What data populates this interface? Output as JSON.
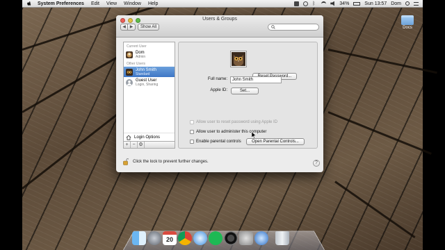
{
  "menubar": {
    "app_name": "System Preferences",
    "items": [
      "Edit",
      "View",
      "Window",
      "Help"
    ],
    "battery": "34%",
    "clock": "Sun 13:57",
    "user": "Dom"
  },
  "desktop": {
    "docs_label": "Docs"
  },
  "window": {
    "title": "Users & Groups",
    "show_all": "Show All",
    "search_placeholder": ""
  },
  "sidebar": {
    "current_user_header": "Current User",
    "other_users_header": "Other Users",
    "current_user": {
      "name": "Dom",
      "role": "Admin"
    },
    "other_users": [
      {
        "name": "John Smith",
        "role": "Standard",
        "selected": true
      },
      {
        "name": "Guest User",
        "role": "Login, Sharing",
        "selected": false
      }
    ],
    "login_options": "Login Options",
    "tools": [
      "+",
      "−",
      "⚙"
    ]
  },
  "detail": {
    "reset_password": "Reset Password...",
    "full_name_label": "Full name:",
    "full_name_value": "John Smith",
    "apple_id_label": "Apple ID:",
    "apple_id_button": "Set...",
    "checkboxes": [
      {
        "label": "Allow user to reset password using Apple ID",
        "checked": false,
        "disabled": true
      },
      {
        "label": "Allow user to administer this computer",
        "checked": false,
        "disabled": false
      },
      {
        "label": "Enable parental controls",
        "checked": false,
        "disabled": false
      }
    ],
    "parental_controls_button": "Open Parental Controls..."
  },
  "footer": {
    "lock_text": "Click the lock to prevent further changes.",
    "help": "?"
  },
  "dock": {
    "icons": [
      "finder-icon",
      "launchpad-icon",
      "calendar-icon",
      "chrome-icon",
      "safari-icon",
      "spotify-icon",
      "camera-icon",
      "system-preferences-icon",
      "quicktime-icon",
      "trash-icon"
    ],
    "calendar_day": "20"
  },
  "colors": {
    "selection": "#3f77c6",
    "wood": "#6d5a45"
  }
}
